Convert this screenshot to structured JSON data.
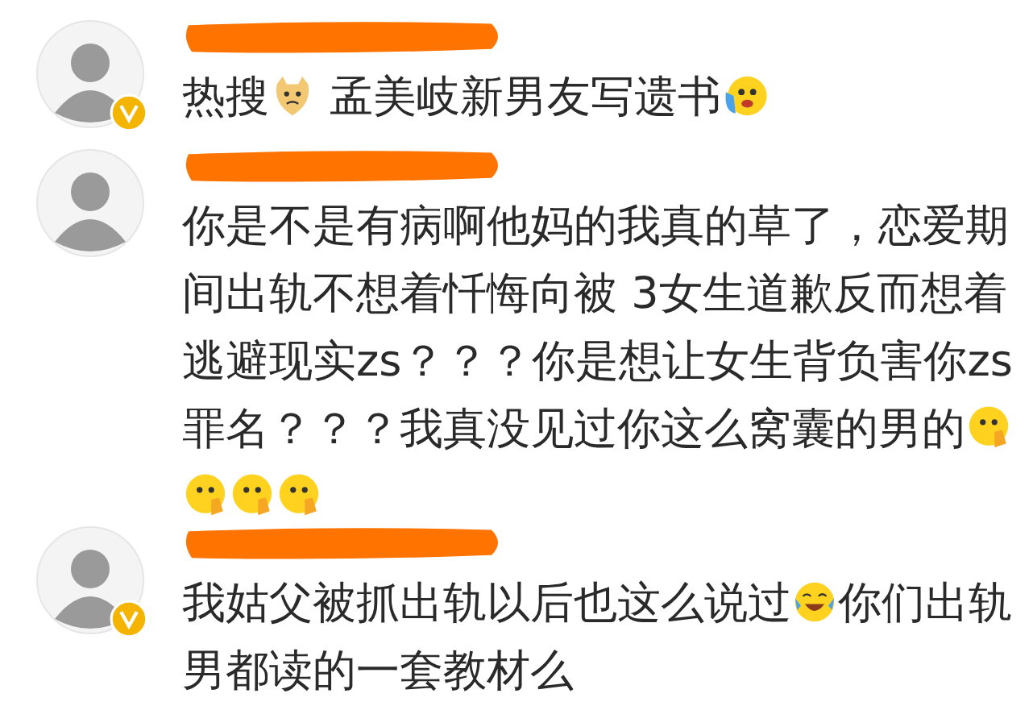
{
  "comments": [
    {
      "verified": true,
      "parts": [
        {
          "kind": "text",
          "text": "热搜"
        },
        {
          "kind": "dog"
        },
        {
          "kind": "text",
          "text": " 孟美岐新男友写遗书"
        },
        {
          "kind": "sob"
        }
      ]
    },
    {
      "verified": false,
      "parts": [
        {
          "kind": "text",
          "text": "你是不是有病啊他妈的我真的草了，恋爱期间出轨不想着忏悔向被 3女生道歉反而想着逃避现实zs？？？你是想让女生背负害你zs罪名？？？我真没见过你这么窝囊的男的"
        },
        {
          "kind": "think"
        },
        {
          "kind": "think"
        },
        {
          "kind": "think"
        },
        {
          "kind": "think"
        }
      ]
    },
    {
      "verified": true,
      "parts": [
        {
          "kind": "text",
          "text": "我姑父被抓出轨以后也这么说过"
        },
        {
          "kind": "laugh"
        },
        {
          "kind": "text",
          "text": "你们出轨男都读的一套教材么"
        }
      ]
    }
  ]
}
